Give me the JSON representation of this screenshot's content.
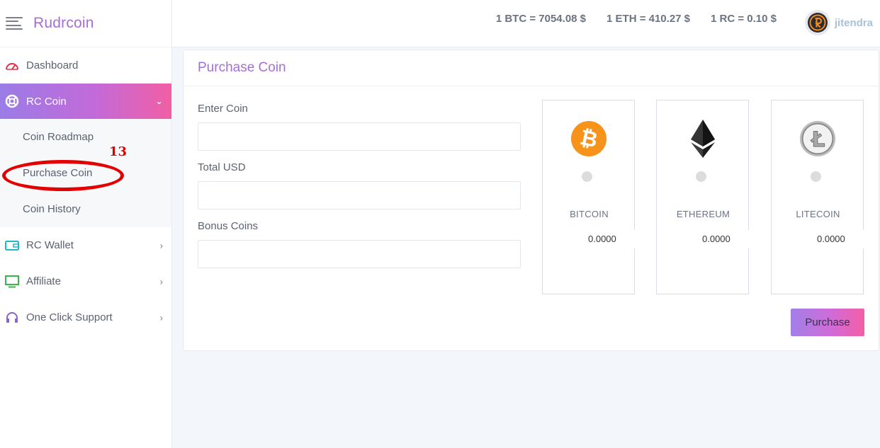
{
  "brand": {
    "name": "Rudrcoin"
  },
  "header": {
    "rates": [
      "1 BTC = 7054.08 $",
      "1 ETH = 410.27 $",
      "1 RC = 0.10 $"
    ],
    "user_name": "jitendra"
  },
  "sidebar": {
    "items": [
      {
        "label": "Dashboard"
      },
      {
        "label": "RC Coin"
      },
      {
        "label": "RC Wallet"
      },
      {
        "label": "Affiliate"
      },
      {
        "label": "One Click Support"
      }
    ],
    "submenu": [
      {
        "label": "Coin Roadmap"
      },
      {
        "label": "Purchase Coin"
      },
      {
        "label": "Coin History"
      }
    ]
  },
  "annotation": {
    "number": "13"
  },
  "main": {
    "title": "Purchase Coin",
    "form": {
      "enter_coin_label": "Enter Coin",
      "total_usd_label": "Total USD",
      "bonus_coins_label": "Bonus Coins"
    },
    "coins": [
      {
        "name": "BITCOIN",
        "amount": "0.0000"
      },
      {
        "name": "ETHEREUM",
        "amount": "0.0000"
      },
      {
        "name": "LITECOIN",
        "amount": "0.0000"
      }
    ],
    "purchase_label": "Purchase"
  },
  "colors": {
    "accent": "#a56ed6",
    "gradient_start": "#9b7ce6",
    "gradient_end": "#f15fa4",
    "bitcoin": "#f7931a",
    "annotation": "#e30000"
  }
}
